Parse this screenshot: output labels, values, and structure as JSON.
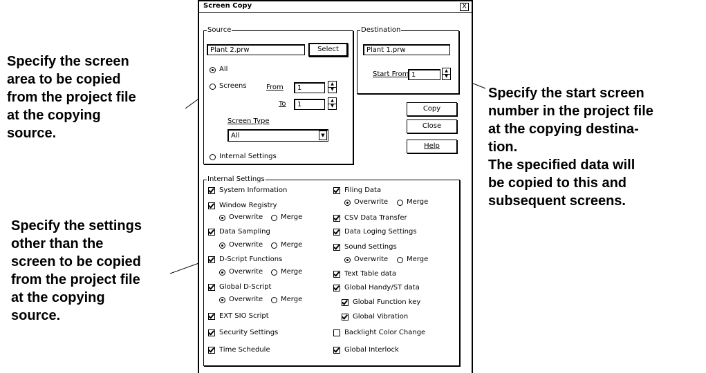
{
  "annotations": {
    "source_area": [
      "Specify the screen",
      "area to be copied",
      "from the project file",
      "at the copying",
      "source."
    ],
    "settings": [
      "Specify the settings",
      "other than the",
      "screen to be copied",
      "from the project file",
      "at the copying",
      "source."
    ],
    "start_screen": [
      "Specify the start screen",
      "number in the project file",
      "at the copying destina-",
      "tion.",
      "The specified data will",
      "be copied to this and",
      "subsequent screens."
    ]
  },
  "dialog": {
    "title": "Screen Copy",
    "close_glyph": "X",
    "source": {
      "legend": "Source",
      "file": "Plant 2.prw",
      "select_label": "Select",
      "all_label": "All",
      "screens_label": "Screens",
      "from_label": "From",
      "from_value": "1",
      "to_label": "To",
      "to_value": "1",
      "screen_type_label": "Screen Type",
      "screen_type_value": "All",
      "internal_settings_label": "Internal Settings"
    },
    "destination": {
      "legend": "Destination",
      "file": "Plant 1.prw",
      "start_from_label": "Start From",
      "start_from_value": "1"
    },
    "buttons": {
      "copy": "Copy",
      "close": "Close",
      "help": "Help"
    },
    "internal": {
      "legend": "Internal Settings",
      "overwrite": "Overwrite",
      "merge": "Merge",
      "left": [
        "System Information",
        "Window Registry",
        "Data Sampling",
        "D-Script Functions",
        "Global D-Script",
        "EXT SIO Script",
        "Security Settings",
        "Time Schedule"
      ],
      "right": [
        "Filing Data",
        "CSV Data Transfer",
        "Data Loging Settings",
        "Sound Settings",
        "Text Table data",
        "Global Handy/ST data",
        "Global Function key",
        "Global Vibration",
        "Backlight Color Change",
        "Global Interlock"
      ]
    }
  }
}
